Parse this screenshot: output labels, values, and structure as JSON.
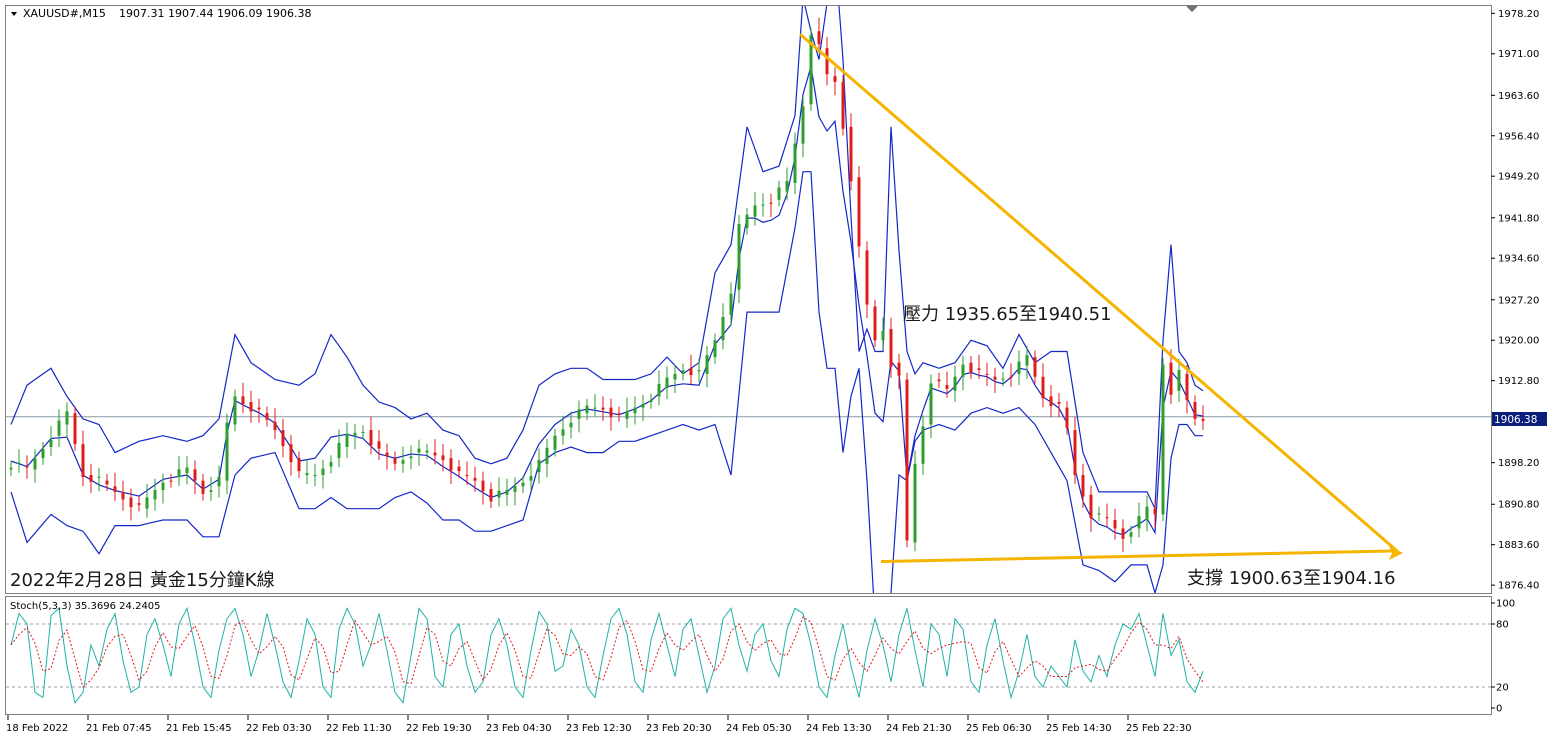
{
  "header": {
    "symbol": "XAUUSD#,M15",
    "ohlc": "1907.31 1907.44 1906.09 1906.38"
  },
  "colors": {
    "bull": "#2e9e2e",
    "bear": "#e01b1b",
    "bands": "#1428c8",
    "trendline": "#f5b400",
    "stoch_main": "#1fb2a8",
    "stoch_signal": "#e01b1b",
    "price_tag_bg": "#0b1f7a"
  },
  "chart_data": {
    "type": "candlestick",
    "symbol": "XAUUSD#",
    "timeframe": "M15",
    "y_ticks": [
      "1978.20",
      "1971.00",
      "1963.60",
      "1956.40",
      "1949.20",
      "1941.80",
      "1934.60",
      "1927.20",
      "1920.00",
      "1912.80",
      "1906.38",
      "1898.20",
      "1890.80",
      "1883.60",
      "1876.40"
    ],
    "ylim": [
      1875.0,
      1979.5
    ],
    "current_price": "1906.38",
    "x_labels": [
      "18 Feb 2022",
      "21 Feb 07:45",
      "21 Feb 15:45",
      "22 Feb 03:30",
      "22 Feb 11:30",
      "22 Feb 19:30",
      "23 Feb 04:30",
      "23 Feb 12:30",
      "23 Feb 20:30",
      "24 Feb 05:30",
      "24 Feb 13:30",
      "24 Feb 21:30",
      "25 Feb 06:30",
      "25 Feb 14:30",
      "25 Feb 22:30"
    ],
    "price_path": [
      [
        0,
        1898
      ],
      [
        2,
        1897
      ],
      [
        5,
        1903
      ],
      [
        7,
        1907
      ],
      [
        9,
        1896
      ],
      [
        11,
        1895
      ],
      [
        13,
        1893
      ],
      [
        16,
        1890
      ],
      [
        19,
        1895
      ],
      [
        22,
        1897
      ],
      [
        24,
        1893
      ],
      [
        26,
        1895
      ],
      [
        27,
        1905
      ],
      [
        28,
        1910
      ],
      [
        30,
        1908
      ],
      [
        31,
        1907
      ],
      [
        33,
        1904
      ],
      [
        35,
        1899
      ],
      [
        36,
        1896
      ],
      [
        38,
        1896
      ],
      [
        40,
        1899
      ],
      [
        42,
        1903
      ],
      [
        44,
        1904
      ],
      [
        46,
        1900
      ],
      [
        48,
        1898
      ],
      [
        50,
        1900
      ],
      [
        52,
        1900
      ],
      [
        54,
        1899
      ],
      [
        56,
        1896
      ],
      [
        58,
        1895
      ],
      [
        60,
        1892
      ],
      [
        62,
        1893
      ],
      [
        64,
        1895
      ],
      [
        66,
        1898
      ],
      [
        68,
        1903
      ],
      [
        70,
        1906
      ],
      [
        72,
        1908
      ],
      [
        74,
        1908
      ],
      [
        76,
        1906
      ],
      [
        78,
        1908
      ],
      [
        80,
        1910
      ],
      [
        82,
        1913
      ],
      [
        84,
        1915
      ],
      [
        86,
        1914
      ],
      [
        88,
        1920
      ],
      [
        90,
        1929
      ],
      [
        91,
        1940
      ],
      [
        93,
        1944
      ],
      [
        95,
        1945
      ],
      [
        97,
        1948
      ],
      [
        99,
        1962
      ],
      [
        100,
        1975
      ],
      [
        101,
        1972
      ],
      [
        102,
        1967
      ],
      [
        103,
        1966
      ],
      [
        104,
        1958
      ],
      [
        105,
        1949
      ],
      [
        106,
        1936
      ],
      [
        107,
        1926
      ],
      [
        108,
        1920
      ],
      [
        109,
        1922
      ],
      [
        110,
        1916
      ],
      [
        111,
        1913
      ],
      [
        112,
        1884
      ],
      [
        113,
        1898
      ],
      [
        114,
        1905
      ],
      [
        115,
        1913
      ],
      [
        117,
        1911
      ],
      [
        119,
        1916
      ],
      [
        121,
        1914
      ],
      [
        123,
        1913
      ],
      [
        125,
        1914
      ],
      [
        127,
        1917
      ],
      [
        129,
        1910
      ],
      [
        131,
        1908
      ],
      [
        132,
        1904
      ],
      [
        133,
        1896
      ],
      [
        135,
        1889
      ],
      [
        137,
        1888
      ],
      [
        139,
        1885
      ],
      [
        141,
        1888
      ],
      [
        142,
        1890
      ],
      [
        143,
        1889
      ],
      [
        144,
        1916
      ],
      [
        145,
        1911
      ],
      [
        146,
        1914
      ],
      [
        147,
        1909
      ],
      [
        148,
        1906
      ],
      [
        149,
        1906
      ]
    ],
    "bands_upper_path": [
      [
        0,
        1905
      ],
      [
        2,
        1912
      ],
      [
        5,
        1915
      ],
      [
        7,
        1910
      ],
      [
        9,
        1906
      ],
      [
        11,
        1905
      ],
      [
        13,
        1900
      ],
      [
        16,
        1902
      ],
      [
        19,
        1903
      ],
      [
        22,
        1902
      ],
      [
        24,
        1903
      ],
      [
        26,
        1906
      ],
      [
        28,
        1921
      ],
      [
        30,
        1916
      ],
      [
        33,
        1913
      ],
      [
        36,
        1912
      ],
      [
        38,
        1914
      ],
      [
        40,
        1921
      ],
      [
        42,
        1917
      ],
      [
        44,
        1912
      ],
      [
        46,
        1909
      ],
      [
        48,
        1908
      ],
      [
        50,
        1906
      ],
      [
        52,
        1907
      ],
      [
        54,
        1904
      ],
      [
        56,
        1903
      ],
      [
        58,
        1899
      ],
      [
        60,
        1898
      ],
      [
        62,
        1899
      ],
      [
        64,
        1904
      ],
      [
        66,
        1912
      ],
      [
        68,
        1914
      ],
      [
        70,
        1915
      ],
      [
        72,
        1915
      ],
      [
        74,
        1913
      ],
      [
        76,
        1913
      ],
      [
        78,
        1913
      ],
      [
        80,
        1914
      ],
      [
        82,
        1917
      ],
      [
        84,
        1914
      ],
      [
        86,
        1916
      ],
      [
        88,
        1932
      ],
      [
        90,
        1937
      ],
      [
        92,
        1958
      ],
      [
        94,
        1950
      ],
      [
        96,
        1951
      ],
      [
        98,
        1960
      ],
      [
        99,
        1981
      ],
      [
        100,
        1975
      ],
      [
        101,
        1970
      ],
      [
        102,
        1980
      ],
      [
        103,
        1989
      ],
      [
        104,
        1970
      ],
      [
        105,
        1942
      ],
      [
        106,
        1918
      ],
      [
        107,
        1922
      ],
      [
        108,
        1918
      ],
      [
        109,
        1918
      ],
      [
        110,
        1958
      ],
      [
        111,
        1936
      ],
      [
        112,
        1918
      ],
      [
        113,
        1914
      ],
      [
        114,
        1916
      ],
      [
        116,
        1915
      ],
      [
        118,
        1916
      ],
      [
        120,
        1920
      ],
      [
        122,
        1919
      ],
      [
        124,
        1915
      ],
      [
        126,
        1921
      ],
      [
        128,
        1916
      ],
      [
        130,
        1918
      ],
      [
        132,
        1918
      ],
      [
        134,
        1900
      ],
      [
        136,
        1893
      ],
      [
        138,
        1893
      ],
      [
        140,
        1893
      ],
      [
        142,
        1893
      ],
      [
        143,
        1890
      ],
      [
        144,
        1920
      ],
      [
        145,
        1937
      ],
      [
        146,
        1918
      ],
      [
        147,
        1916
      ],
      [
        148,
        1912
      ],
      [
        149,
        1911
      ]
    ],
    "bands_lower_path": [
      [
        0,
        1893
      ],
      [
        2,
        1884
      ],
      [
        5,
        1889
      ],
      [
        7,
        1887
      ],
      [
        9,
        1886
      ],
      [
        11,
        1882
      ],
      [
        13,
        1887
      ],
      [
        16,
        1887
      ],
      [
        19,
        1888
      ],
      [
        22,
        1888
      ],
      [
        24,
        1885
      ],
      [
        26,
        1885
      ],
      [
        28,
        1896
      ],
      [
        30,
        1899
      ],
      [
        33,
        1900
      ],
      [
        36,
        1890
      ],
      [
        38,
        1890
      ],
      [
        40,
        1892
      ],
      [
        42,
        1890
      ],
      [
        44,
        1890
      ],
      [
        46,
        1890
      ],
      [
        48,
        1892
      ],
      [
        50,
        1893
      ],
      [
        52,
        1891
      ],
      [
        54,
        1888
      ],
      [
        56,
        1888
      ],
      [
        58,
        1886
      ],
      [
        60,
        1886
      ],
      [
        62,
        1887
      ],
      [
        64,
        1888
      ],
      [
        66,
        1898
      ],
      [
        68,
        1900
      ],
      [
        70,
        1901
      ],
      [
        72,
        1900
      ],
      [
        74,
        1900
      ],
      [
        76,
        1902
      ],
      [
        78,
        1902
      ],
      [
        80,
        1903
      ],
      [
        82,
        1904
      ],
      [
        84,
        1905
      ],
      [
        86,
        1904
      ],
      [
        88,
        1905
      ],
      [
        90,
        1896
      ],
      [
        92,
        1925
      ],
      [
        94,
        1925
      ],
      [
        96,
        1925
      ],
      [
        98,
        1940
      ],
      [
        99,
        1950
      ],
      [
        100,
        1950
      ],
      [
        101,
        1925
      ],
      [
        102,
        1915
      ],
      [
        103,
        1915
      ],
      [
        104,
        1900
      ],
      [
        105,
        1910
      ],
      [
        106,
        1915
      ],
      [
        107,
        1895
      ],
      [
        108,
        1870
      ],
      [
        109,
        1860
      ],
      [
        110,
        1875
      ],
      [
        111,
        1896
      ],
      [
        112,
        1895
      ],
      [
        113,
        1902
      ],
      [
        114,
        1904
      ],
      [
        116,
        1905
      ],
      [
        118,
        1904
      ],
      [
        120,
        1907
      ],
      [
        122,
        1908
      ],
      [
        124,
        1907
      ],
      [
        126,
        1908
      ],
      [
        128,
        1905
      ],
      [
        130,
        1900
      ],
      [
        132,
        1895
      ],
      [
        134,
        1880
      ],
      [
        136,
        1879
      ],
      [
        138,
        1877
      ],
      [
        140,
        1880
      ],
      [
        142,
        1880
      ],
      [
        143,
        1875
      ],
      [
        144,
        1880
      ],
      [
        145,
        1899
      ],
      [
        146,
        1905
      ],
      [
        147,
        1905
      ],
      [
        148,
        1903
      ],
      [
        149,
        1903
      ]
    ],
    "annotations": {
      "resistance": "壓力 1935.65至1940.51",
      "support": "支撐 1900.63至1904.16",
      "caption": "2022年2月28日 黃金15分鐘K線"
    },
    "stochastic": {
      "label": "Stoch(5,3,3) 35.3696 24.2405",
      "y_ticks": [
        "100",
        "80",
        "20",
        "0"
      ],
      "levels": [
        20,
        80
      ],
      "k_path": [
        [
          0,
          60
        ],
        [
          1,
          90
        ],
        [
          2,
          80
        ],
        [
          3,
          15
        ],
        [
          4,
          10
        ],
        [
          5,
          88
        ],
        [
          6,
          95
        ],
        [
          7,
          40
        ],
        [
          8,
          5
        ],
        [
          9,
          15
        ],
        [
          10,
          60
        ],
        [
          11,
          40
        ],
        [
          12,
          75
        ],
        [
          13,
          90
        ],
        [
          14,
          45
        ],
        [
          15,
          15
        ],
        [
          16,
          20
        ],
        [
          17,
          70
        ],
        [
          18,
          85
        ],
        [
          19,
          60
        ],
        [
          20,
          30
        ],
        [
          21,
          80
        ],
        [
          22,
          95
        ],
        [
          23,
          60
        ],
        [
          24,
          20
        ],
        [
          25,
          10
        ],
        [
          26,
          55
        ],
        [
          27,
          85
        ],
        [
          28,
          95
        ],
        [
          29,
          70
        ],
        [
          30,
          30
        ],
        [
          31,
          55
        ],
        [
          32,
          90
        ],
        [
          33,
          60
        ],
        [
          34,
          25
        ],
        [
          35,
          10
        ],
        [
          36,
          45
        ],
        [
          37,
          85
        ],
        [
          38,
          70
        ],
        [
          39,
          20
        ],
        [
          40,
          10
        ],
        [
          41,
          75
        ],
        [
          42,
          95
        ],
        [
          43,
          80
        ],
        [
          44,
          40
        ],
        [
          45,
          60
        ],
        [
          46,
          90
        ],
        [
          47,
          55
        ],
        [
          48,
          15
        ],
        [
          49,
          5
        ],
        [
          50,
          50
        ],
        [
          51,
          95
        ],
        [
          52,
          85
        ],
        [
          53,
          30
        ],
        [
          54,
          20
        ],
        [
          55,
          70
        ],
        [
          56,
          80
        ],
        [
          57,
          40
        ],
        [
          58,
          15
        ],
        [
          59,
          25
        ],
        [
          60,
          70
        ],
        [
          61,
          85
        ],
        [
          62,
          60
        ],
        [
          63,
          20
        ],
        [
          64,
          10
        ],
        [
          65,
          55
        ],
        [
          66,
          92
        ],
        [
          67,
          80
        ],
        [
          68,
          35
        ],
        [
          69,
          40
        ],
        [
          70,
          75
        ],
        [
          71,
          60
        ],
        [
          72,
          20
        ],
        [
          73,
          10
        ],
        [
          74,
          50
        ],
        [
          75,
          85
        ],
        [
          76,
          95
        ],
        [
          77,
          70
        ],
        [
          78,
          25
        ],
        [
          79,
          15
        ],
        [
          80,
          65
        ],
        [
          81,
          90
        ],
        [
          82,
          60
        ],
        [
          83,
          30
        ],
        [
          84,
          75
        ],
        [
          85,
          85
        ],
        [
          86,
          50
        ],
        [
          87,
          15
        ],
        [
          88,
          40
        ],
        [
          89,
          85
        ],
        [
          90,
          95
        ],
        [
          91,
          60
        ],
        [
          92,
          35
        ],
        [
          93,
          70
        ],
        [
          94,
          80
        ],
        [
          95,
          45
        ],
        [
          96,
          30
        ],
        [
          97,
          75
        ],
        [
          98,
          95
        ],
        [
          99,
          90
        ],
        [
          100,
          60
        ],
        [
          101,
          20
        ],
        [
          102,
          10
        ],
        [
          103,
          50
        ],
        [
          104,
          80
        ],
        [
          105,
          40
        ],
        [
          106,
          10
        ],
        [
          107,
          55
        ],
        [
          108,
          85
        ],
        [
          109,
          60
        ],
        [
          110,
          25
        ],
        [
          111,
          70
        ],
        [
          112,
          95
        ],
        [
          113,
          55
        ],
        [
          114,
          20
        ],
        [
          115,
          80
        ],
        [
          116,
          70
        ],
        [
          117,
          30
        ],
        [
          118,
          85
        ],
        [
          119,
          75
        ],
        [
          120,
          25
        ],
        [
          121,
          15
        ],
        [
          122,
          60
        ],
        [
          123,
          85
        ],
        [
          124,
          45
        ],
        [
          125,
          10
        ],
        [
          126,
          35
        ],
        [
          127,
          70
        ],
        [
          128,
          30
        ],
        [
          129,
          20
        ],
        [
          130,
          40
        ],
        [
          131,
          30
        ],
        [
          132,
          20
        ],
        [
          133,
          65
        ],
        [
          134,
          35
        ],
        [
          135,
          25
        ],
        [
          136,
          50
        ],
        [
          137,
          30
        ],
        [
          138,
          60
        ],
        [
          139,
          80
        ],
        [
          140,
          75
        ],
        [
          141,
          90
        ],
        [
          142,
          60
        ],
        [
          143,
          30
        ],
        [
          144,
          90
        ],
        [
          145,
          50
        ],
        [
          146,
          65
        ],
        [
          147,
          25
        ],
        [
          148,
          15
        ],
        [
          149,
          35
        ]
      ]
    }
  }
}
